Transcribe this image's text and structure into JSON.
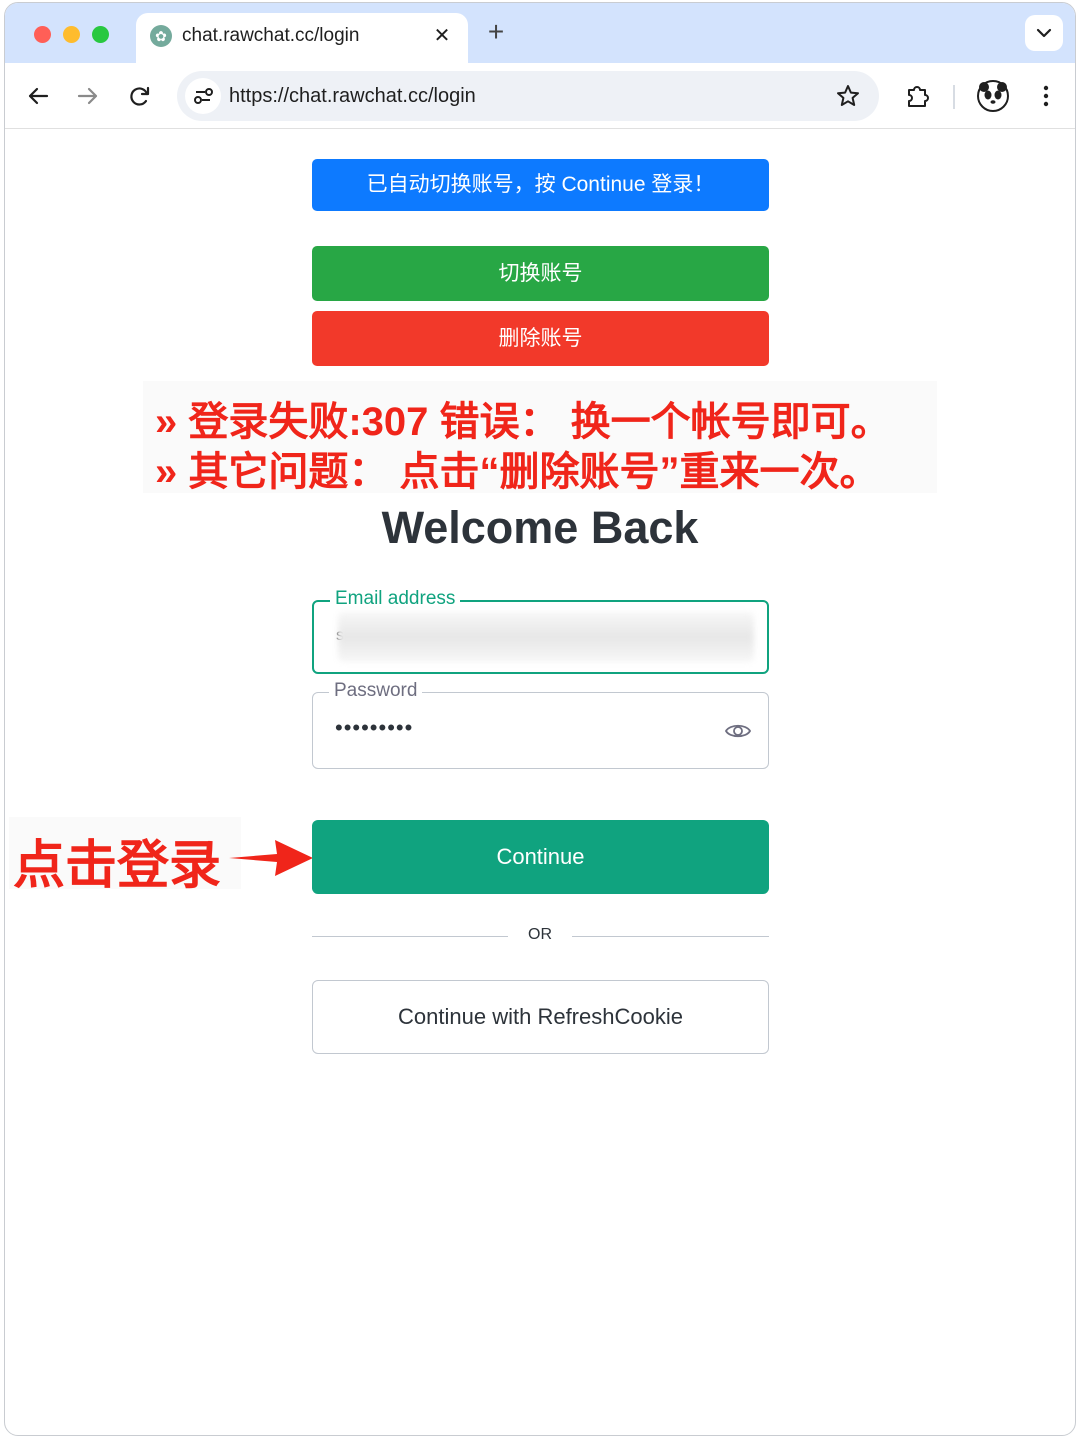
{
  "browser": {
    "tab_title": "chat.rawchat.cc/login",
    "tab_close": "✕",
    "new_tab": "+",
    "url": "https://chat.rawchat.cc/login"
  },
  "banner": {
    "notice": "已自动切换账号，按 Continue 登录！",
    "switch_account": "切换账号",
    "delete_account": "删除账号"
  },
  "annotations": {
    "line1": "» 登录失败:307 错误： 换一个帐号即可。",
    "line2": "» 其它问题： 点击“删除账号”重来一次。",
    "click_login": "点击登录"
  },
  "login": {
    "title": "Welcome Back",
    "email_label": "Email address",
    "email_value_visible": "s",
    "password_label": "Password",
    "password_value": "•••••••••",
    "continue_label": "Continue",
    "or_label": "OR",
    "refresh_cookie_label": "Continue with RefreshCookie"
  },
  "colors": {
    "brand": "#10a37f",
    "notice_blue": "#0d7aff",
    "switch_green": "#28a745",
    "delete_red": "#f2392a",
    "annotation_red": "#f0251a"
  }
}
